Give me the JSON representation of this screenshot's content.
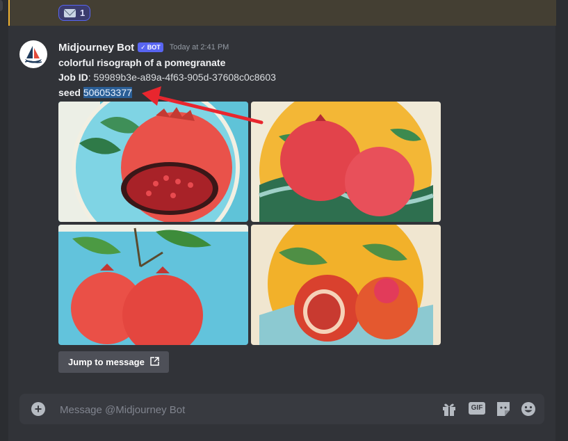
{
  "previous_message": {
    "reaction": {
      "icon": "envelope-icon",
      "count": "1"
    }
  },
  "message": {
    "author": "Midjourney Bot",
    "badge": "BOT",
    "timestamp": "Today at 2:41 PM",
    "prompt": "colorful risograph of a pomegranate",
    "job_id_label": "Job ID",
    "job_id_value": ": 59989b3e-a89a-4f63-905d-37608c0c8603",
    "seed_label": "seed",
    "seed_value": "506053377",
    "images": [
      {
        "name": "pomegranate-image-1",
        "background": "#5fc3d8"
      },
      {
        "name": "pomegranate-image-2",
        "background": "#f3b736"
      },
      {
        "name": "pomegranate-image-3",
        "background": "#62c3dc"
      },
      {
        "name": "pomegranate-image-4",
        "background": "#f2b12a"
      }
    ],
    "jump_button": "Jump to message"
  },
  "composer": {
    "placeholder": "Message @Midjourney Bot",
    "icons": [
      "add-icon",
      "gift-icon",
      "gif-icon",
      "sticker-icon",
      "emoji-icon"
    ],
    "gif_label": "GIF"
  },
  "colors": {
    "background": "#313338",
    "accent": "#5865f2",
    "highlight": "#2a5e96",
    "arrow": "#e8262e"
  }
}
